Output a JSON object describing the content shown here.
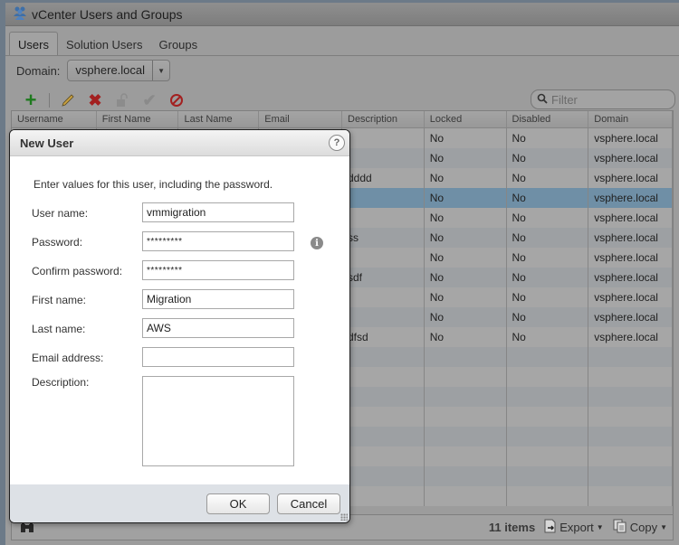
{
  "window": {
    "title": "vCenter Users and Groups",
    "icon": "users-group-icon"
  },
  "tabs": [
    {
      "label": "Users",
      "active": true
    },
    {
      "label": "Solution Users",
      "active": false
    },
    {
      "label": "Groups",
      "active": false
    }
  ],
  "domain": {
    "label": "Domain:",
    "selected": "vsphere.local"
  },
  "toolbar": {
    "icons": [
      "add-icon",
      "edit-icon",
      "delete-icon",
      "unlock-icon",
      "enable-icon",
      "disable-icon"
    ],
    "filter_placeholder": "Filter"
  },
  "grid": {
    "columns": [
      "Username",
      "First Name",
      "Last Name",
      "Email",
      "Description",
      "Locked",
      "Disabled",
      "Domain"
    ],
    "rows": [
      {
        "description": "",
        "locked": "No",
        "disabled": "No",
        "domain": "vsphere.local"
      },
      {
        "description": "",
        "locked": "No",
        "disabled": "No",
        "domain": "vsphere.local"
      },
      {
        "description": "dddd",
        "locked": "No",
        "disabled": "No",
        "domain": "vsphere.local"
      },
      {
        "description": "",
        "locked": "No",
        "disabled": "No",
        "domain": "vsphere.local",
        "selected": true
      },
      {
        "description": "",
        "locked": "No",
        "disabled": "No",
        "domain": "vsphere.local"
      },
      {
        "description": "ss",
        "locked": "No",
        "disabled": "No",
        "domain": "vsphere.local"
      },
      {
        "description": "",
        "locked": "No",
        "disabled": "No",
        "domain": "vsphere.local"
      },
      {
        "description": "sdf",
        "locked": "No",
        "disabled": "No",
        "domain": "vsphere.local"
      },
      {
        "description": "",
        "locked": "No",
        "disabled": "No",
        "domain": "vsphere.local"
      },
      {
        "description": "",
        "locked": "No",
        "disabled": "No",
        "domain": "vsphere.local"
      },
      {
        "description": "dfsd",
        "locked": "No",
        "disabled": "No",
        "domain": "vsphere.local"
      }
    ]
  },
  "statusbar": {
    "count": "11 items",
    "export_label": "Export",
    "copy_label": "Copy"
  },
  "dialog": {
    "title": "New User",
    "intro": "Enter values for this user, including the password.",
    "fields": {
      "username": {
        "label": "User name:",
        "value": "vmmigration"
      },
      "password": {
        "label": "Password:",
        "value": "*********"
      },
      "confirm_password": {
        "label": "Confirm password:",
        "value": "*********"
      },
      "first_name": {
        "label": "First name:",
        "value": "Migration"
      },
      "last_name": {
        "label": "Last name:",
        "value": "AWS"
      },
      "email": {
        "label": "Email address:",
        "value": ""
      },
      "description": {
        "label": "Description:",
        "value": ""
      }
    },
    "ok_label": "OK",
    "cancel_label": "Cancel"
  },
  "colors": {
    "selected_row": "#6f8fa6",
    "add_green": "#1e7a1e",
    "delete_red": "#a32020"
  }
}
